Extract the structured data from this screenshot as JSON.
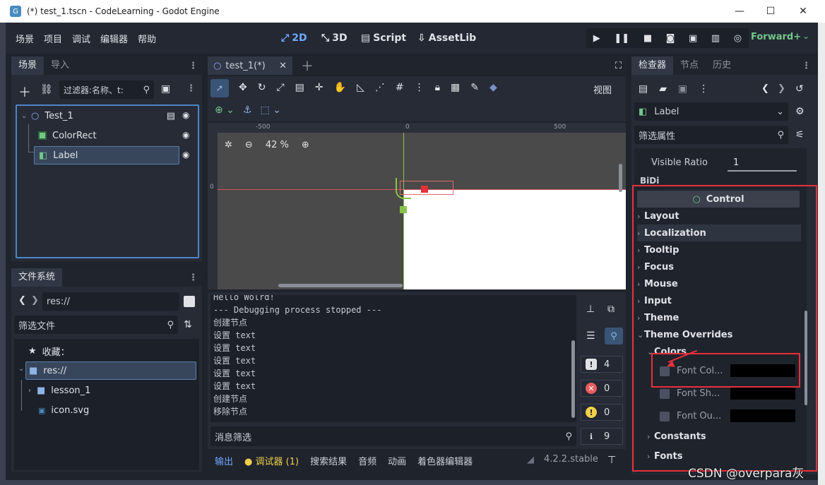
{
  "window": {
    "title": "(*) test_1.tscn - CodeLearning - Godot Engine",
    "min": "—",
    "max": "☐",
    "close": "✕"
  },
  "menu": [
    "场景",
    "项目",
    "调试",
    "编辑器",
    "帮助"
  ],
  "modes": {
    "m2d": "2D",
    "m3d": "3D",
    "script": "Script",
    "assetlib": "AssetLib"
  },
  "renderer": "Forward+",
  "scene_dock": {
    "tab_scene": "场景",
    "tab_import": "导入",
    "filter_placeholder": "过滤器:名称、t:",
    "nodes": [
      {
        "name": "Test_1"
      },
      {
        "name": "ColorRect"
      },
      {
        "name": "Label"
      }
    ]
  },
  "fs_dock": {
    "title": "文件系统",
    "path": "res://",
    "filter_placeholder": "筛选文件",
    "favorites": "收藏：",
    "items": [
      {
        "name": "res://"
      },
      {
        "name": "lesson_1"
      },
      {
        "name": "icon.svg"
      }
    ]
  },
  "editor": {
    "tab": "test_1(*)",
    "view_label": "视图",
    "zoom": "42 %",
    "ruler": [
      "-500",
      "0",
      "500"
    ],
    "vruler": "0"
  },
  "console": {
    "lines": [
      "Hello Wolrd!",
      "--- Debugging process stopped ---",
      "创建节点",
      "设置 text",
      "设置 text",
      "设置 text",
      "设置 text",
      "设置 text",
      "创建节点",
      "移除节点"
    ],
    "filter_placeholder": "消息筛选",
    "counts": {
      "msgs": "4",
      "errors": "0",
      "warnings": "0",
      "misc": "9"
    }
  },
  "bottom_tabs": [
    "输出",
    "调试器 (1)",
    "搜索结果",
    "音频",
    "动画",
    "着色器编辑器"
  ],
  "version": "4.2.2.stable",
  "inspector": {
    "tabs": [
      "检查器",
      "节点",
      "历史"
    ],
    "node_type": "Label",
    "filter_placeholder": "筛选属性",
    "visible_ratio_label": "Visible Ratio",
    "visible_ratio_value": "1",
    "bidi": "BiDi",
    "control": "Control",
    "sections": [
      "Layout",
      "Localization",
      "Tooltip",
      "Focus",
      "Mouse",
      "Input",
      "Theme",
      "Theme Overrides"
    ],
    "colors": "Colors",
    "color_props": [
      "Font Col...",
      "Font Sh...",
      "Font Ou..."
    ],
    "constants": "Constants",
    "fonts": "Fonts"
  },
  "watermark": "CSDN @overpara灰",
  "colors": {
    "accent": "#478cbf",
    "highlight": "#e8303a",
    "renderer": "#74c88a"
  }
}
